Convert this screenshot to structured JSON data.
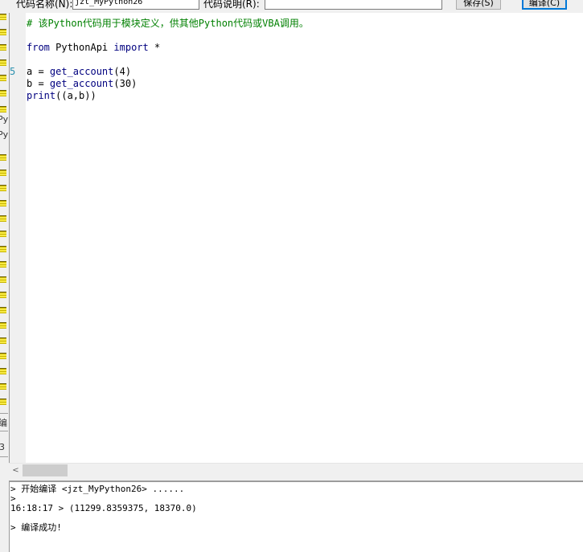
{
  "toolbar": {
    "code_name_label": "代码名称(N):",
    "code_name_value": "jzt_MyPython26",
    "code_desc_label": "代码说明(R):",
    "code_desc_value": "",
    "save_label": "保存(S)",
    "compile_label": "编译(C)"
  },
  "left_strip": {
    "snippets": [
      "Py",
      "Py",
      "编",
      "3"
    ]
  },
  "editor": {
    "gutter_marks": [
      "5"
    ],
    "lines": [
      {
        "parts": [
          {
            "t": "# 该Python代码用于模块定义，供其他Python代码或VBA调用。",
            "c": "comment"
          }
        ]
      },
      {
        "parts": []
      },
      {
        "parts": [
          {
            "t": "from",
            "c": "kw"
          },
          {
            "t": " PythonApi ",
            "c": ""
          },
          {
            "t": "import",
            "c": "kw"
          },
          {
            "t": " *",
            "c": ""
          }
        ]
      },
      {
        "parts": []
      },
      {
        "parts": [
          {
            "t": "a = ",
            "c": ""
          },
          {
            "t": "get_account",
            "c": "fn"
          },
          {
            "t": "(4)",
            "c": ""
          }
        ]
      },
      {
        "parts": [
          {
            "t": "b = ",
            "c": ""
          },
          {
            "t": "get_account",
            "c": "fn"
          },
          {
            "t": "(30)",
            "c": ""
          }
        ]
      },
      {
        "parts": [
          {
            "t": "print",
            "c": "builtin"
          },
          {
            "t": "((a,b))",
            "c": ""
          }
        ]
      }
    ]
  },
  "scrollbar": {
    "left_arrow": "<"
  },
  "output": {
    "lines": [
      "> 开始编译 <jzt_MyPython26> ......",
      ">",
      "16:18:17 > (11299.8359375, 18370.0)",
      "",
      "> 编译成功!"
    ]
  }
}
